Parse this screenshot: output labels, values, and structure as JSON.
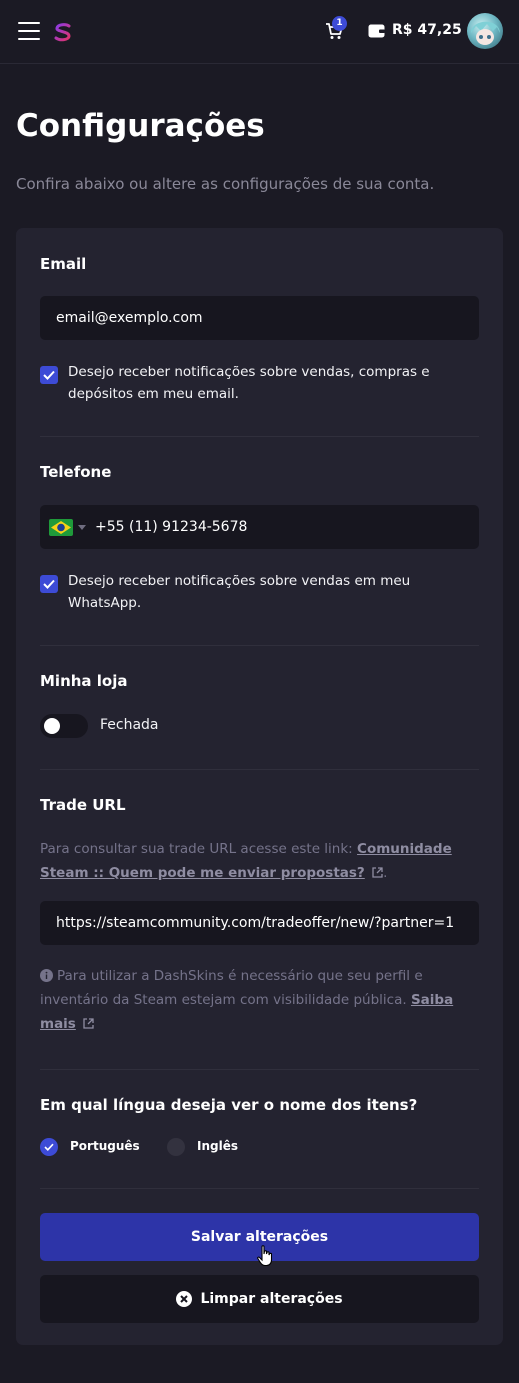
{
  "header": {
    "cart_count": "1",
    "balance": "R$ 47,25",
    "icons": [
      "menu-icon",
      "logo-icon",
      "cart-icon",
      "wallet-icon",
      "avatar"
    ]
  },
  "page": {
    "title": "Configurações",
    "subtitle": "Confira abaixo ou altere as configurações de sua conta."
  },
  "email": {
    "title": "Email",
    "value": "email@exemplo.com",
    "notify_checked": true,
    "notify_line1": "Desejo receber notificações sobre vendas, compras e",
    "notify_line2": "depósitos em meu email."
  },
  "phone": {
    "title": "Telefone",
    "country": "BR",
    "value": "+55 (11) 91234-5678",
    "notify_checked": true,
    "notify_line1": "Desejo receber notificações sobre vendas em meu",
    "notify_line2": "WhatsApp."
  },
  "store": {
    "title": "Minha loja",
    "open": false,
    "status": "Fechada"
  },
  "trade": {
    "title": "Trade URL",
    "help_line1_prefix": "Para consultar sua trade URL acesse este link:",
    "help_link_part1": "Comunidade",
    "help_link_part2": "Steam :: Quem pode me enviar propostas?",
    "help_suffix": ".",
    "value": "https://steamcommunity.com/tradeoffer/new/?partner=1",
    "info_line1": "Para utilizar a DashSkins é necessário que seu perfil e",
    "info_line2_prefix": "inventário da Steam estejam com visibilidade pública.",
    "info_link_part1": "Saiba",
    "info_link_part2": "mais"
  },
  "language": {
    "title": "Em qual língua deseja ver o nome dos itens?",
    "options": [
      {
        "label": "Português",
        "selected": true
      },
      {
        "label": "Inglês",
        "selected": false
      }
    ]
  },
  "actions": {
    "save": "Salvar alterações",
    "clear": "Limpar alterações"
  },
  "colors": {
    "background": "#1b1a24",
    "card": "#242330",
    "accent": "#3d4bd6",
    "primary_button": "#2d34a8"
  }
}
